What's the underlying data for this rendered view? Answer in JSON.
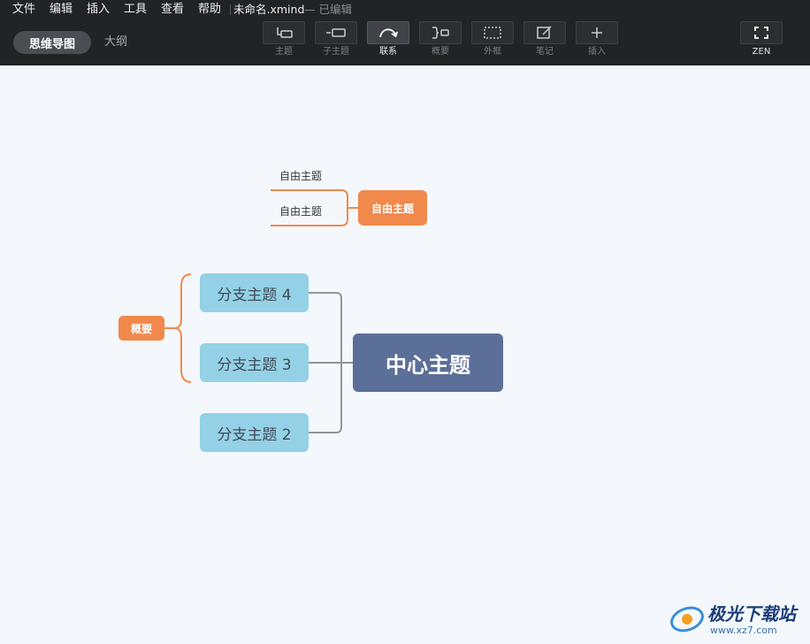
{
  "menu": [
    "文件",
    "编辑",
    "插入",
    "工具",
    "查看",
    "帮助"
  ],
  "document": {
    "title": "未命名.xmind",
    "status": "— 已编辑"
  },
  "views": {
    "mindmap": "思维导图",
    "outline": "大纲"
  },
  "toolbar": [
    {
      "label": "主题",
      "icon": "topic-icon"
    },
    {
      "label": "子主题",
      "icon": "subtopic-icon"
    },
    {
      "label": "联系",
      "icon": "relationship-icon",
      "active": true
    },
    {
      "label": "概要",
      "icon": "summary-icon"
    },
    {
      "label": "外框",
      "icon": "boundary-icon"
    },
    {
      "label": "笔记",
      "icon": "note-icon"
    },
    {
      "label": "插入",
      "icon": "insert-icon"
    }
  ],
  "zen": {
    "label": "ZEN",
    "icon": "fullscreen-icon"
  },
  "mindmap": {
    "central_topic": "中心主题",
    "branches": [
      "分支主题 4",
      "分支主题 3",
      "分支主题 2"
    ],
    "summary": "概要",
    "floating_topic": "自由主题",
    "floating_subtopics": [
      "自由主题",
      "自由主题"
    ]
  },
  "colors": {
    "toolbar_bg": "#212325",
    "canvas_bg": "#f4f8fc",
    "central": "#5b6f98",
    "branch": "#94d1e6",
    "accent": "#f1894c",
    "connector": "#8f96a0"
  },
  "watermark": {
    "text": "极光下载站",
    "url": "www.xz7.com"
  }
}
